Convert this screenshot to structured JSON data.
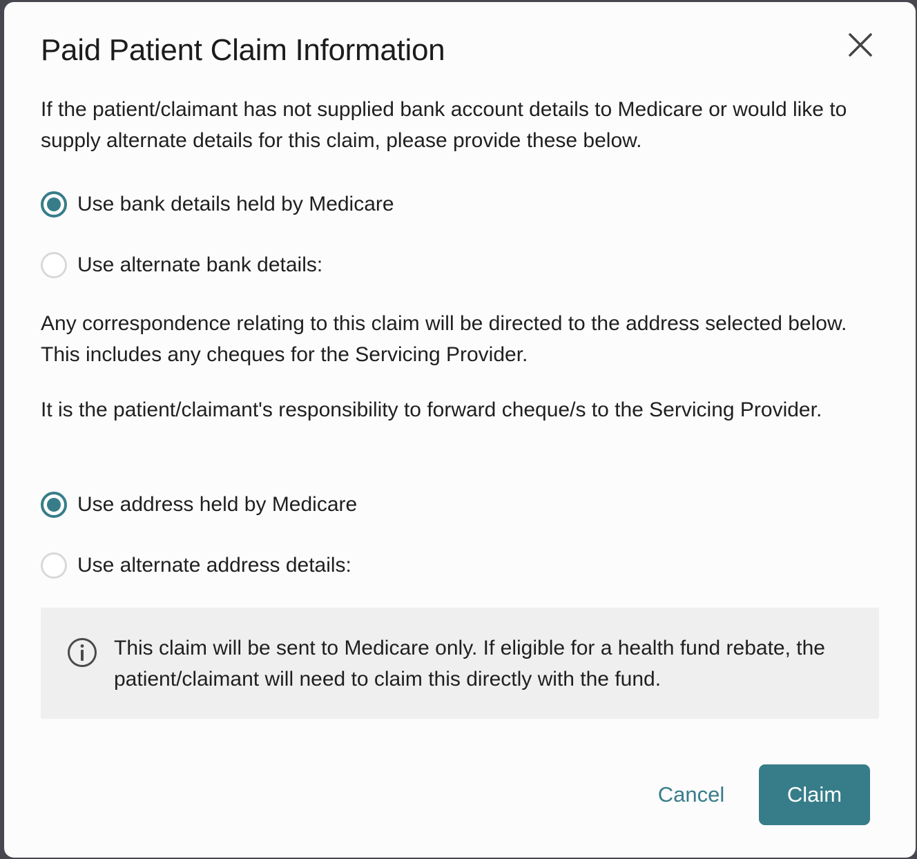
{
  "modal": {
    "title": "Paid Patient Claim Information",
    "intro": "If the patient/claimant has not supplied bank account details to Medicare or would like to supply alternate details for this claim, please provide these below.",
    "bank_options": [
      {
        "label": "Use bank details held by Medicare",
        "checked": true
      },
      {
        "label": "Use alternate bank details:",
        "checked": false
      }
    ],
    "correspondence_text": "Any correspondence relating to this claim will be directed to the address selected below. This includes any cheques for the Servicing Provider.",
    "responsibility_text": "It is the patient/claimant's responsibility to forward cheque/s to the Servicing Provider.",
    "address_options": [
      {
        "label": "Use address held by Medicare",
        "checked": true
      },
      {
        "label": "Use alternate address details:",
        "checked": false
      }
    ],
    "info_icon": "info-circle-icon",
    "info_text": "This claim will be sent to Medicare only. If eligible for a health fund rebate, the patient/claimant will need to claim this directly with the fund.",
    "close_icon": "close-icon",
    "cancel_label": "Cancel",
    "claim_label": "Claim"
  },
  "colors": {
    "accent": "#377d89",
    "info_bg": "#efefef",
    "modal_bg": "#fcfcfc"
  }
}
